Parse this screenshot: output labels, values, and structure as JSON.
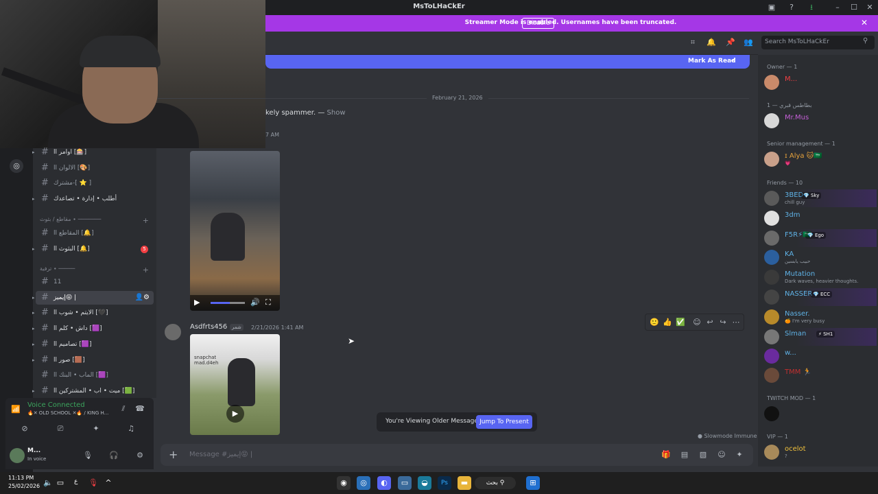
{
  "window": {
    "title": "MsToLHaCkEr"
  },
  "streamer": {
    "message": "Streamer Mode is enabled. Usernames have been truncated.",
    "disable_label": "Disable"
  },
  "search": {
    "placeholder": "Search MsToLHaCkEr"
  },
  "unread_bar": {
    "label": "Mark As Read"
  },
  "messages": {
    "date_divider": "February 21, 2026",
    "spam_text": "kely spammer. —",
    "spam_show": "Show",
    "partial_time": "7 AM",
    "msg2": {
      "author": "Asdfrts456",
      "author_tag": "شمر",
      "time": "2/21/2026 1:41 AM",
      "video_caption": "snapchat\nmad.d4eh"
    },
    "older_label": "You're Viewing Older Messages",
    "jump_label": "Jump To Present",
    "slowmode": "Slowmode Immune"
  },
  "composer": {
    "placeholder": "Message #إيميز😝 |"
  },
  "channels": [
    {
      "label": "اوامر اا [🎰]",
      "expand": true,
      "style": "bright"
    },
    {
      "label": "الالوان اا [🎨]",
      "expand": false,
      "style": "muted"
    },
    {
      "label": "مشترك-[ ⭐ ]",
      "expand": false,
      "style": "muted"
    },
    {
      "label": "أطلب • إدارة • تصاعدك",
      "expand": true,
      "style": "bright"
    }
  ],
  "category1": "مقاطع / بثوث ∙ ───────",
  "channels2": [
    {
      "label": "المقاطع اا [🔔]",
      "expand": false,
      "style": "muted",
      "badge": ""
    },
    {
      "label": "البثوث اا [🔔]",
      "expand": true,
      "style": "bright",
      "badge": "5"
    }
  ],
  "category2": "ترفية ∙ ─────",
  "channels3": [
    {
      "label": "11",
      "expand": false,
      "style": "muted"
    },
    {
      "label": "إيميز😝 |",
      "expand": true,
      "style": "active"
    },
    {
      "label": "الايتم • شوب اا [🖤]",
      "expand": true,
      "style": "bright"
    },
    {
      "label": "داش • كلم اا [🟪]",
      "expand": true,
      "style": "bright"
    },
    {
      "label": "تصاميم اا [🟪]",
      "expand": true,
      "style": "bright"
    },
    {
      "label": "صور اا [🟫]",
      "expand": true,
      "style": "bright"
    },
    {
      "label": "الماب • البنك اا [🟪]",
      "expand": false,
      "style": "muted"
    },
    {
      "label": "ميت • اب • المشتركين اا [🟩]",
      "expand": true,
      "style": "bright"
    }
  ],
  "voice": {
    "status": "Voice Connected",
    "server": "🔥✕ OLD SCHOOL ✕🔥 / KING H..."
  },
  "user": {
    "name": "M...",
    "status": "In voice"
  },
  "members": {
    "groups": [
      {
        "title": "Owner — 1"
      },
      {
        "title": "بطاطس قبري — 1"
      },
      {
        "title": "Senior management — 1"
      },
      {
        "title": "Friends — 10"
      },
      {
        "title": "TWITCH MOD — 1"
      },
      {
        "title": "VIP — 1"
      }
    ],
    "list": [
      {
        "name": "M...",
        "status": "",
        "tag": "",
        "color": "#f23f43",
        "av": "#c98a6a"
      },
      {
        "name": "Mr.Mus",
        "status": "",
        "tag": "",
        "color": "#c45fd6",
        "av": "#d8d8d8"
      },
      {
        "name": "ɪ Alya 🐱🇸🇦",
        "status": "💗",
        "tag": "",
        "color": "#e6a23c",
        "av": "#c9a08a"
      },
      {
        "name": "3BED",
        "status": "chill guy",
        "tag": "💎 Sky",
        "color": "#5fb2e6",
        "av": "#5a5a5a"
      },
      {
        "name": "3dm",
        "status": "",
        "tag": "",
        "color": "#5fb2e6",
        "av": "#e0e0e0"
      },
      {
        "name": "F5R⚡🇸🇦",
        "status": "",
        "tag": "💎 Ego",
        "color": "#5fb2e6",
        "av": "#6a6a6a"
      },
      {
        "name": "KA",
        "status": "حبيب يابسين",
        "tag": "",
        "color": "#5fb2e6",
        "av": "#2b5f9e"
      },
      {
        "name": "Mutation",
        "status": "Dark waves, heavier thoughts.",
        "tag": "",
        "color": "#5fb2e6",
        "av": "#3a3a3a"
      },
      {
        "name": "NASSER",
        "status": "",
        "tag": "💎 ECC",
        "color": "#5fb2e6",
        "av": "#444"
      },
      {
        "name": "Nasser.",
        "status": "🍊 I'm very busy",
        "tag": "",
        "color": "#5fb2e6",
        "av": "#b88a2a"
      },
      {
        "name": "Slman",
        "status": "",
        "tag": "⚡ SH1",
        "color": "#5fb2e6",
        "av": "#777"
      },
      {
        "name": "w...",
        "status": "",
        "tag": "",
        "color": "#5fb2e6",
        "av": "#6a2b9e"
      },
      {
        "name": "TMM 🏃",
        "status": "",
        "tag": "",
        "color": "#c22f2f",
        "av": "#6a4a3a"
      },
      {
        "name": "",
        "status": "",
        "tag": "",
        "color": "#5fb2e6",
        "av": "#111"
      },
      {
        "name": "ocelot",
        "status": "?",
        "tag": "",
        "color": "#f0c13c",
        "av": "#a88a5a"
      }
    ]
  },
  "taskbar": {
    "time": "11:13 PM",
    "date": "25/02/2026",
    "lang": "ع",
    "search": "بحث"
  }
}
